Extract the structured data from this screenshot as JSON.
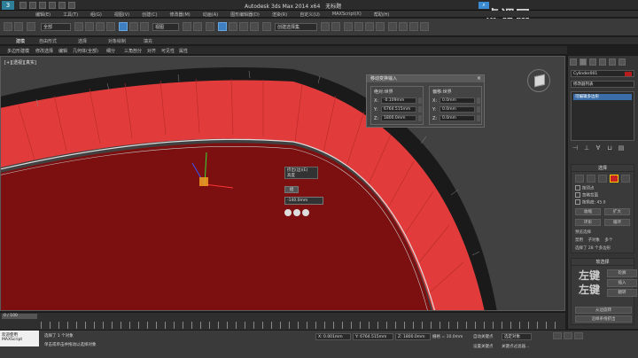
{
  "window": {
    "title": "Autodesk 3ds Max  2014 x64",
    "doc_title": "无标题"
  },
  "menu": [
    "编辑(E)",
    "工具(T)",
    "组(G)",
    "视图(V)",
    "创建(C)",
    "修改器(M)",
    "动画(A)",
    "图形编辑器(D)",
    "渲染(R)",
    "自定义(U)",
    "MAXScript(X)",
    "帮助(H)"
  ],
  "toolbar": {
    "selection_filter": "全部",
    "view_dropdown": "视图",
    "named_set": "创建选择集"
  },
  "ribbon": {
    "tabs": [
      "建模",
      "自由形式",
      "选择",
      "对象绘制",
      "填充"
    ],
    "sub_items": [
      "多边形建模",
      "修改选择",
      "编辑",
      "几何体(全部)",
      "细分",
      "三角剖分",
      "对齐",
      "可见性",
      "属性"
    ]
  },
  "viewport": {
    "label": "[+][透视][真实]"
  },
  "transform_dialog": {
    "title": "移动变换输入",
    "absolute_title": "绝对:世界",
    "offset_title": "偏移:世界",
    "absolute": {
      "x": "-0.109mm",
      "y": "6764.515mm",
      "z": "1800.0mm"
    },
    "offset": {
      "x": "0.0mm",
      "y": "0.0mm",
      "z": "0.0mm"
    },
    "axes": [
      "X:",
      "Y:",
      "Z:"
    ]
  },
  "caddy": {
    "tooltip_line1": "挤出(边)(E)",
    "tooltip_line2": "高度",
    "button": "组",
    "field": "-140.0mm"
  },
  "command_panel": {
    "object_name": "Cylinder001",
    "modifier_list": "修改器列表",
    "stack_item": "可编辑多边形",
    "selection_title": "选择",
    "by_vertex": "按顶点",
    "ignore_backfacing": "忽略背面",
    "by_angle": "按角度:",
    "by_angle_value": "45.0",
    "shrink": "收缩",
    "grow": "扩大",
    "ring": "环形",
    "loop": "循环",
    "selection_info": "选择了 28 个多边形",
    "preview_selection": "预览选择",
    "preview_options": [
      "禁用",
      "子对象",
      "多个"
    ],
    "soft_selection_title": "软选择",
    "watermark": "左键",
    "extra_btns": [
      "轮廓",
      "插入",
      "翻转"
    ],
    "bottom_btns": [
      "从边旋转",
      "沿样条线挤出"
    ]
  },
  "timeline": {
    "frame": "0 / 100"
  },
  "status": {
    "maxscript_label": "欢迎使用 MAXScript",
    "selected": "选择了 1 个对象",
    "hint": "单击或单击并拖动以选择对象",
    "x": "X: 0.001mm",
    "y": "Y: 6764.515mm",
    "z": "Z: 1800.0mm",
    "grid": "栅格 = 10.0mm",
    "autokey": "自动关键点",
    "key_mode": "选定对象",
    "setkey": "设置关键点",
    "key_filter": "关键点过滤器..."
  },
  "brand": "虎课网",
  "colors": {
    "red_bright": "#e33e3e",
    "red_dark": "#7c1010",
    "select_blue": "#3b6ea8"
  }
}
